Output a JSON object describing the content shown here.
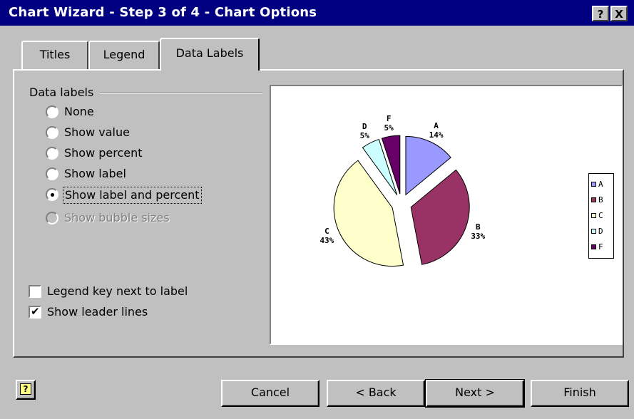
{
  "window": {
    "title": "Chart Wizard - Step 3 of 4 - Chart Options",
    "help_btn": "?",
    "close_btn": "X"
  },
  "tabs": [
    {
      "label": "Titles"
    },
    {
      "label": "Legend"
    },
    {
      "label": "Data Labels",
      "active": true
    }
  ],
  "data_labels": {
    "group_label": "Data labels",
    "options": [
      {
        "label": "None",
        "selected": false,
        "disabled": false
      },
      {
        "label": "Show value",
        "selected": false,
        "disabled": false
      },
      {
        "label": "Show percent",
        "selected": false,
        "disabled": false
      },
      {
        "label": "Show label",
        "selected": false,
        "disabled": false
      },
      {
        "label": "Show label and percent",
        "selected": true,
        "disabled": false
      },
      {
        "label": "Show bubble sizes",
        "selected": false,
        "disabled": true
      }
    ],
    "legend_key": {
      "label": "Legend key next to label",
      "checked": false
    },
    "leader_lines": {
      "label": "Show leader lines",
      "checked": true
    }
  },
  "chart_data": {
    "type": "pie",
    "categories": [
      "A",
      "B",
      "C",
      "D",
      "F"
    ],
    "values": [
      14,
      33,
      43,
      5,
      5
    ],
    "labels": [
      "A\n14%",
      "B\n33%",
      "C\n43%",
      "D\n5%",
      "F\n5%"
    ],
    "colors": [
      "#9999ff",
      "#993366",
      "#ffffcc",
      "#ccffff",
      "#660066"
    ],
    "legend": [
      "A",
      "B",
      "C",
      "D",
      "F"
    ],
    "legend_position": "right"
  },
  "buttons": {
    "cancel": "Cancel",
    "back": "< Back",
    "next": "Next >",
    "finish": "Finish"
  }
}
